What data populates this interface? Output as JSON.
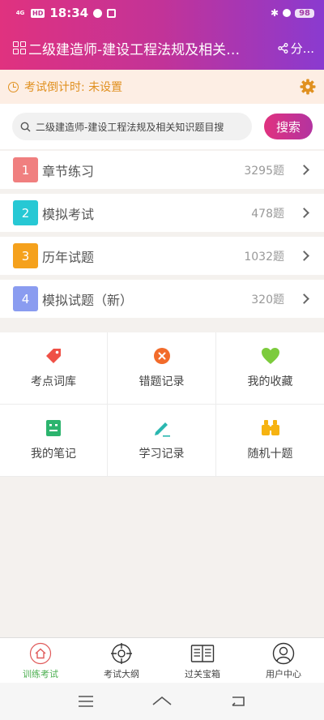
{
  "status_bar": {
    "network": "4G",
    "hd": "HD",
    "time": "18:34",
    "battery": "98"
  },
  "header": {
    "title": "二级建造师-建设工程法规及相关…",
    "share_label": "分..."
  },
  "countdown": {
    "text": "考试倒计时: 未设置"
  },
  "search": {
    "value": "二级建造师-建设工程法规及相关知识题目搜",
    "button_label": "搜索"
  },
  "menu": [
    {
      "num": "1",
      "label": "章节练习",
      "count": "3295题",
      "color": "#f07f7f"
    },
    {
      "num": "2",
      "label": "模拟考试",
      "count": "478题",
      "color": "#27c8d4"
    },
    {
      "num": "3",
      "label": "历年试题",
      "count": "1032题",
      "color": "#f5a11c"
    },
    {
      "num": "4",
      "label": "模拟试题（新）",
      "count": "320题",
      "color": "#8a9cf0"
    }
  ],
  "tools": [
    {
      "label": "考点词库",
      "icon": "tag-icon"
    },
    {
      "label": "错题记录",
      "icon": "x-circle-icon"
    },
    {
      "label": "我的收藏",
      "icon": "heart-icon"
    },
    {
      "label": "我的笔记",
      "icon": "note-icon"
    },
    {
      "label": "学习记录",
      "icon": "pencil-icon"
    },
    {
      "label": "随机十题",
      "icon": "binoculars-icon"
    }
  ],
  "tabbar": [
    {
      "label": "训练考试",
      "icon": "home-icon",
      "active": true
    },
    {
      "label": "考试大纲",
      "icon": "target-icon",
      "active": false
    },
    {
      "label": "过关宝箱",
      "icon": "book-icon",
      "active": false
    },
    {
      "label": "用户中心",
      "icon": "user-icon",
      "active": false
    }
  ],
  "colors": {
    "brand_start": "#e0327f",
    "brand_end": "#8a3ad0",
    "accent_orange": "#e0901f",
    "active_green": "#4caf50"
  }
}
